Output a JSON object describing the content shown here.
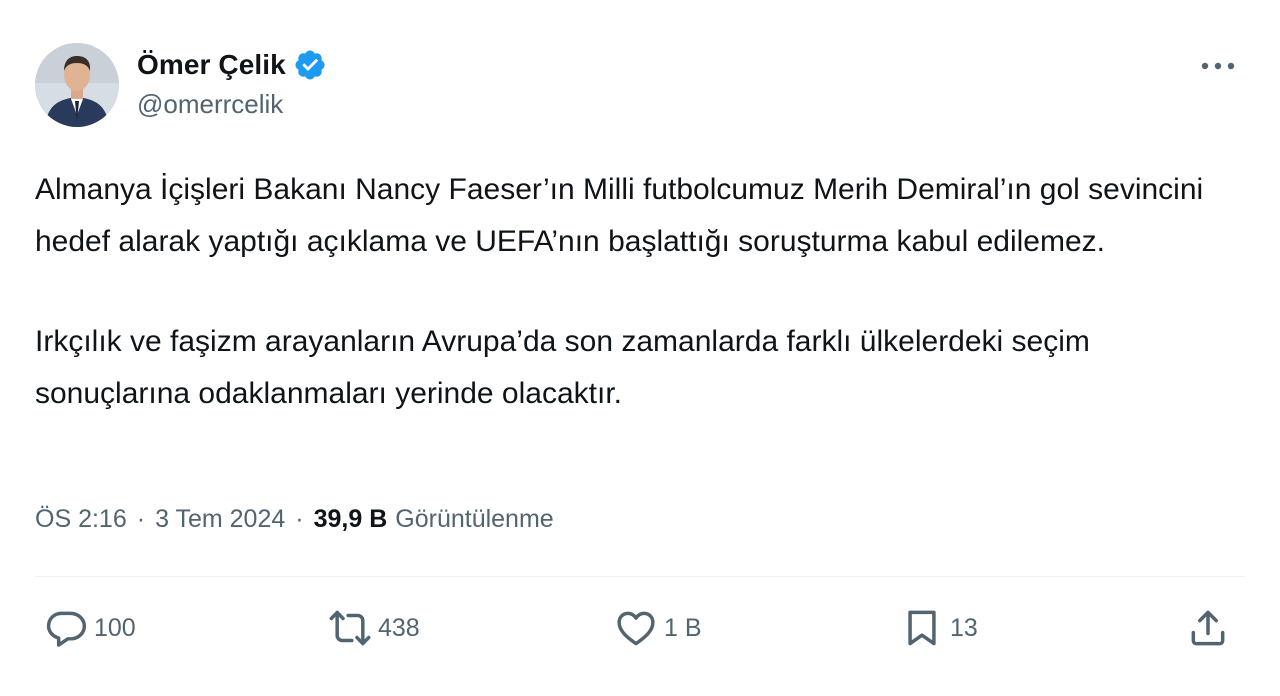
{
  "author": {
    "display_name": "Ömer Çelik",
    "handle": "@omerrcelik",
    "verified": true
  },
  "tweet": {
    "paragraphs": [
      "Almanya İçişleri Bakanı Nancy Faeser’ın Milli futbolcumuz Merih Demiral’ın gol sevincini hedef alarak yaptığı açıklama ve UEFA’nın başlattığı soruşturma kabul edilemez.",
      "Irkçılık ve faşizm arayanların Avrupa’da son zamanlarda farklı ülkelerdeki seçim sonuçlarına odaklanmaları yerinde olacaktır."
    ],
    "time": "ÖS 2:16",
    "separator": "·",
    "date": "3 Tem 2024",
    "views_count": "39,9 B",
    "views_label": "Görüntülenme"
  },
  "actions": {
    "replies": "100",
    "reposts": "438",
    "likes": "1 B",
    "bookmarks": "13"
  },
  "icons": {
    "verified": "verified-badge-icon",
    "more": "more-options-icon",
    "reply": "reply-icon",
    "repost": "repost-icon",
    "like": "heart-icon",
    "bookmark": "bookmark-icon",
    "share": "share-icon"
  },
  "colors": {
    "text_primary": "#0f1419",
    "text_secondary": "#536471",
    "verified_blue": "#1d9bf0",
    "divider": "#eff3f4"
  }
}
